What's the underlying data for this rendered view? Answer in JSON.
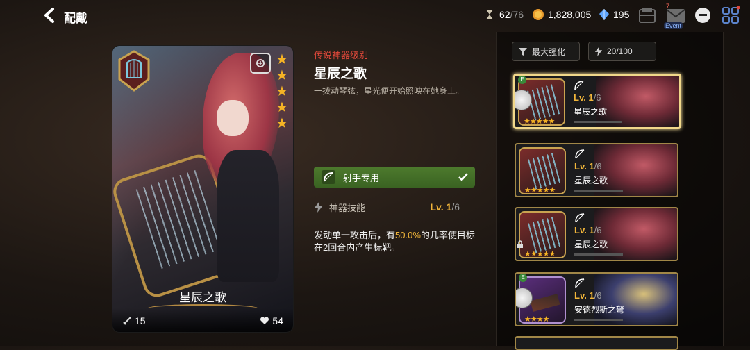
{
  "header": {
    "back_icon": "chevron-left-icon",
    "title": "配戴",
    "stamina_current": "62",
    "stamina_max": "/76",
    "gold": "1,828,005",
    "crystal": "195",
    "mail_badge": "7",
    "event_label": "Event"
  },
  "card": {
    "name": "星辰之歌",
    "atk": "15",
    "hp": "54",
    "stars": 5
  },
  "artifact": {
    "grade": "传说神器级别",
    "name": "星辰之歌",
    "description": "一拨动琴弦，星光便开始照映在她身上。",
    "role_label": "射手专用",
    "skill_label": "神器技能",
    "skill_level": "Lv. 1",
    "skill_max": "/6",
    "skill_desc_1": "发动单一攻击后，有",
    "skill_desc_highlight": "50.0%",
    "skill_desc_2": "的几率使目标在2回合内产生标靶。"
  },
  "panel": {
    "sort_label": "最大强化",
    "capacity": "20/100",
    "slots": [
      {
        "level": "Lv. 1",
        "max": "/6",
        "name": "星辰之歌",
        "badge": "E",
        "selected": true
      },
      {
        "level": "Lv. 1",
        "max": "/6",
        "name": "星辰之歌",
        "badge": "",
        "selected": false
      },
      {
        "level": "Lv. 1",
        "max": "/6",
        "name": "星辰之歌",
        "badge": "",
        "selected": false
      },
      {
        "level": "Lv. 1",
        "max": "/6",
        "name": "安德烈斯之弩",
        "badge": "E",
        "selected": false
      }
    ]
  },
  "colors": {
    "accent_gold": "#f2b63a",
    "grade_red": "#e0483a",
    "role_green": "#4d7a2d"
  }
}
